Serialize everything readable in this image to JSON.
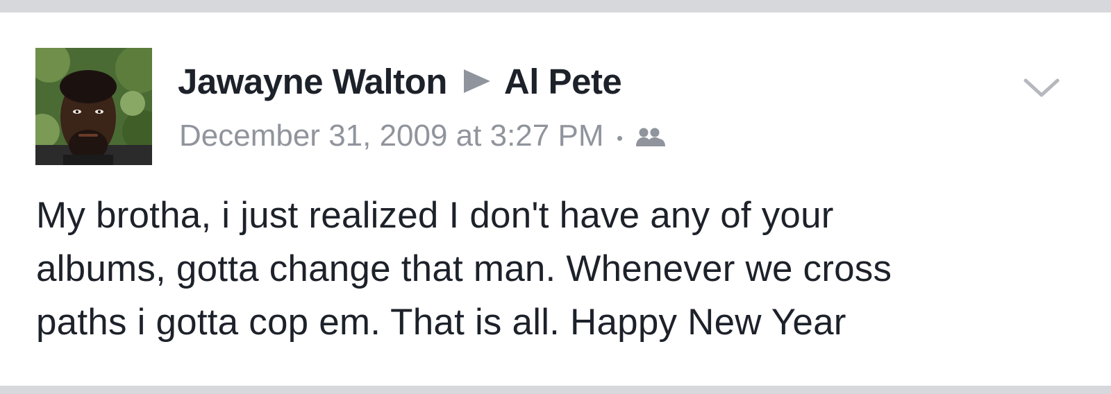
{
  "post": {
    "author": "Jawayne Walton",
    "recipient": "Al Pete",
    "timestamp": "December 31, 2009 at 3:27 PM",
    "separator": "·",
    "audience_icon": "friends-icon",
    "options_icon": "chevron-down-icon",
    "avatar_icon": "profile-photo",
    "body_lines": [
      "My brotha, i just realized I don't have any of your",
      "albums, gotta change that man. Whenever we cross",
      "paths i gotta cop em. That is all. Happy New Year"
    ]
  },
  "colors": {
    "text": "#1d2129",
    "meta": "#90949c",
    "divider": "#d6d8dc",
    "background": "#ffffff"
  }
}
